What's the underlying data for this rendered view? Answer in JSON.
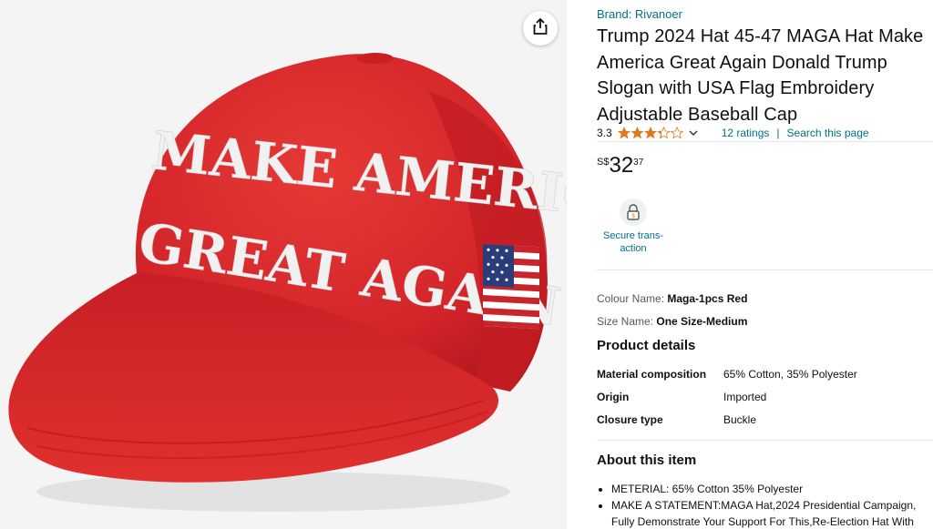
{
  "image": {
    "hat_line1": "MAKE AMERICA",
    "hat_line2": "GREAT AGAIN",
    "share_icon": "share-icon",
    "colors": {
      "background": "#f4f4f4",
      "hat_red": "#d8262b"
    }
  },
  "product": {
    "brand": "Brand: Rivanoer",
    "title": "Trump 2024 Hat 45-47 MAGA Hat Make America Great Again Donald Trump Slogan with USA Flag Embroidery Adjustable Baseball Cap",
    "rating": "3.3",
    "rating_stars": 3.3,
    "ratings_count": "12 ratings",
    "search_link": "Search this page",
    "separator": "|"
  },
  "price": {
    "currency": "S$",
    "whole": "32",
    "fraction": "37"
  },
  "secure": {
    "label": "Secure trans-action",
    "label_line1": "Secure trans-",
    "label_line2": "action"
  },
  "variations": {
    "colour_label": "Colour Name:",
    "colour_value": "Maga-1pcs Red",
    "size_label": "Size Name:",
    "size_value": "One Size-Medium"
  },
  "product_details": {
    "heading": "Product details",
    "rows": [
      {
        "key": "Material composition",
        "value": "65% Cotton, 35% Polyester"
      },
      {
        "key": "Origin",
        "value": "Imported"
      },
      {
        "key": "Closure type",
        "value": "Buckle"
      }
    ]
  },
  "about": {
    "heading": "About this item",
    "bullets": [
      "METERIAL: 65% Cotton 35% Polyester",
      "MAKE A STATEMENT:MAGA Hat,2024 Presidential Campaign, Fully Demonstrate Your Support For This,Re-Election Hat With"
    ]
  },
  "colors": {
    "link": "#007185",
    "star": "#de7921",
    "text": "#0f1111"
  }
}
